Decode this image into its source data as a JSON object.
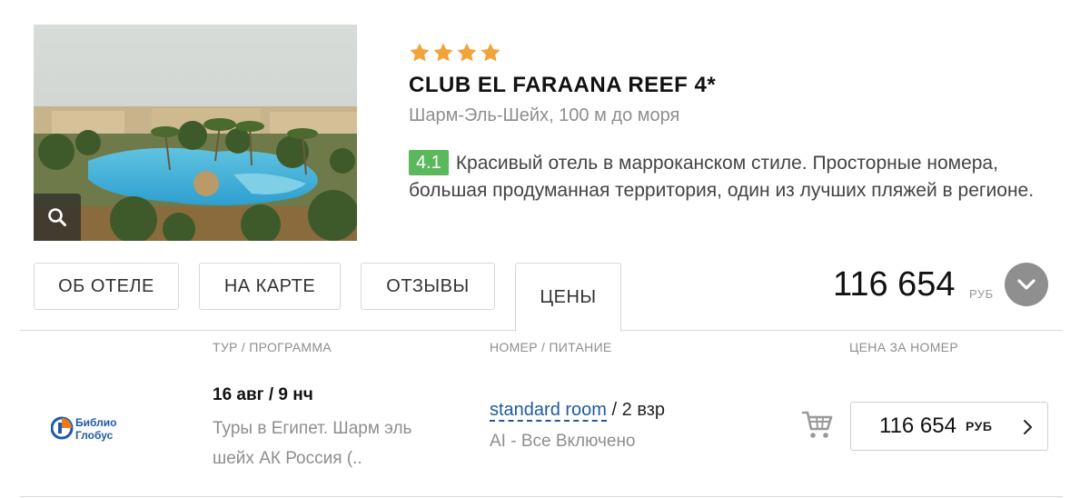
{
  "hotel": {
    "stars": 4,
    "name": "CLUB EL FARAANA REEF 4*",
    "location": "Шарм-Эль-Шейх, 100 м до моря",
    "rating": "4.1",
    "description": "Красивый отель в марроканском стиле. Просторные номера, большая продуманная территория, один из лучших пляжей в регионе."
  },
  "tabs": [
    {
      "label": "ОБ ОТЕЛЕ"
    },
    {
      "label": "НА КАРТЕ"
    },
    {
      "label": "ОТЗЫВЫ"
    },
    {
      "label": "ЦЕНЫ",
      "active": true
    }
  ],
  "header_price": {
    "value": "116 654",
    "currency": "РУБ"
  },
  "columns": {
    "tour": "ТУР / ПРОГРАММА",
    "room": "НОМЕР / ПИТАНИЕ",
    "price": "ЦЕНА ЗА НОМЕР"
  },
  "offer": {
    "operator_logo_lines": [
      "Библио",
      "Глобус"
    ],
    "date": "16 авг / 9 нч",
    "program": "Туры в Египет. Шарм эль шейх АК Россия (..",
    "room_type": "standard room",
    "guests": " / 2 взр",
    "meal": "AI - Все Включено",
    "price": "116 654",
    "currency": "РУБ"
  },
  "colors": {
    "star": "#f2a33a",
    "rating_badge": "#5cb85c",
    "room_link": "#1f5a9e",
    "logo_blue": "#1f5aa8",
    "logo_orange": "#f07a1a"
  },
  "icons": {
    "zoom": "search-icon",
    "expand": "chevron-down-icon",
    "cart": "cart-icon",
    "price_arrow": "chevron-right-icon"
  }
}
